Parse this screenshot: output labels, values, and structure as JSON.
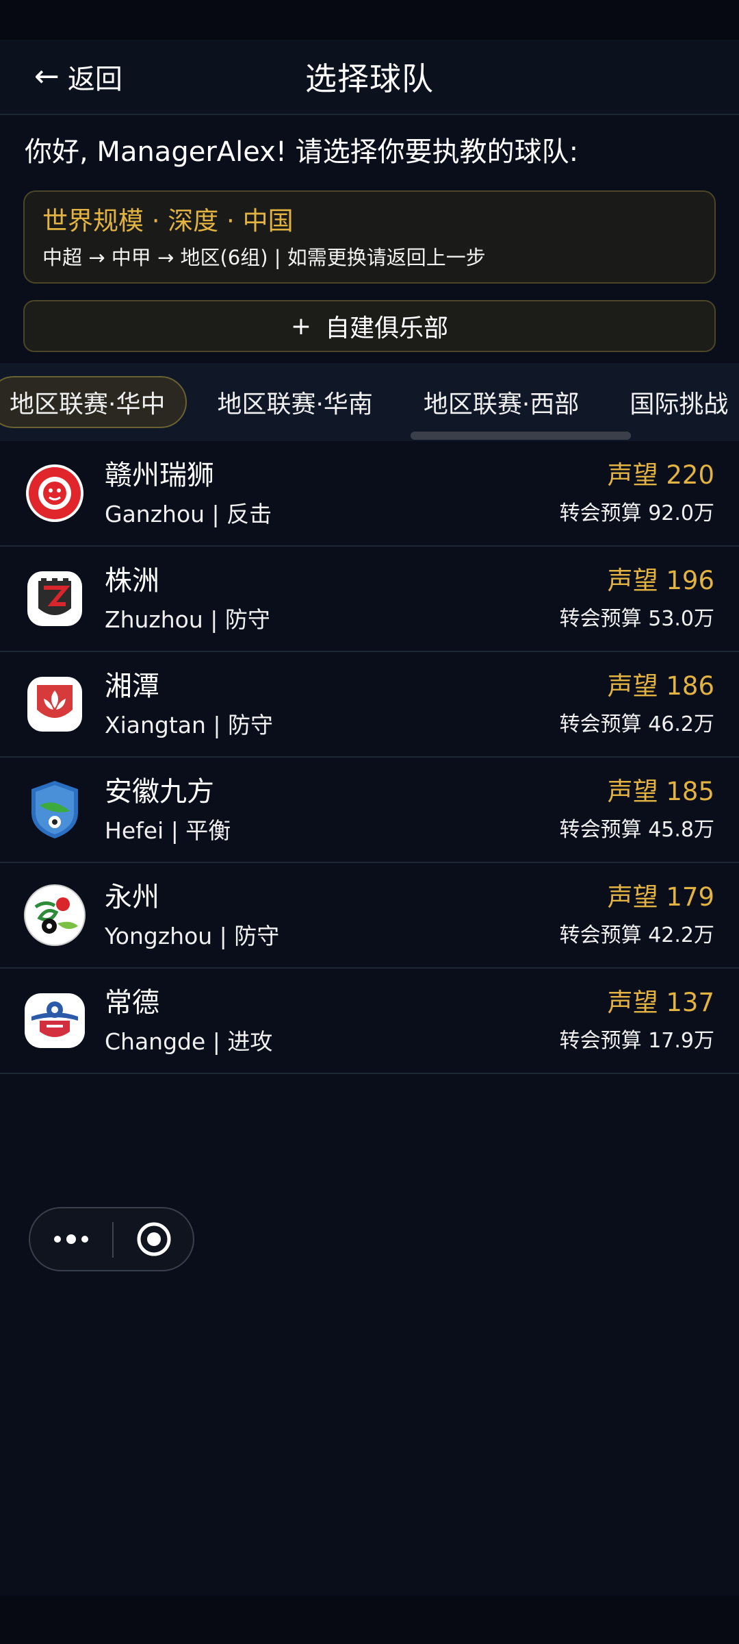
{
  "header": {
    "back_label": "返回",
    "title": "选择球队"
  },
  "greeting": "你好, ManagerAlex! 请选择你要执教的球队:",
  "info_card": {
    "title": "世界规模 · 深度 · 中国",
    "subtitle": "中超 → 中甲 → 地区(6组) | 如需更换请返回上一步"
  },
  "custom_club": {
    "icon": "+",
    "label": "自建俱乐部"
  },
  "tabs": [
    {
      "label": "地区联赛·华中",
      "active": true
    },
    {
      "label": "地区联赛·华南",
      "active": false
    },
    {
      "label": "地区联赛·西部",
      "active": false
    },
    {
      "label": "国际挑战",
      "active": false
    }
  ],
  "teams": [
    {
      "name": "赣州瑞狮",
      "sub": "Ganzhou | 反击",
      "reputation": "声望 220",
      "budget": "转会预算 92.0万",
      "logo": "lion-crest-icon",
      "color": "#e0262b"
    },
    {
      "name": "株洲",
      "sub": "Zhuzhou | 防守",
      "reputation": "声望 196",
      "budget": "转会预算 53.0万",
      "logo": "castle-crest-icon",
      "color": "#c8252b"
    },
    {
      "name": "湘潭",
      "sub": "Xiangtan | 防守",
      "reputation": "声望 186",
      "budget": "转会预算 46.2万",
      "logo": "lotus-crest-icon",
      "color": "#d63a3a"
    },
    {
      "name": "安徽九方",
      "sub": "Hefei | 平衡",
      "reputation": "声望 185",
      "budget": "转会预算 45.8万",
      "logo": "shield-ball-icon",
      "color": "#2a6fc0"
    },
    {
      "name": "永州",
      "sub": "Yongzhou | 防守",
      "reputation": "声望 179",
      "budget": "转会预算 42.2万",
      "logo": "calligraphy-ball-icon",
      "color": "#2e8b3a"
    },
    {
      "name": "常德",
      "sub": "Changde | 进攻",
      "reputation": "声望 137",
      "budget": "转会预算 17.9万",
      "logo": "wing-ball-icon",
      "color": "#d32f3f"
    }
  ],
  "colors": {
    "accent_gold": "#e3b341",
    "background": "#0a0e1a"
  }
}
